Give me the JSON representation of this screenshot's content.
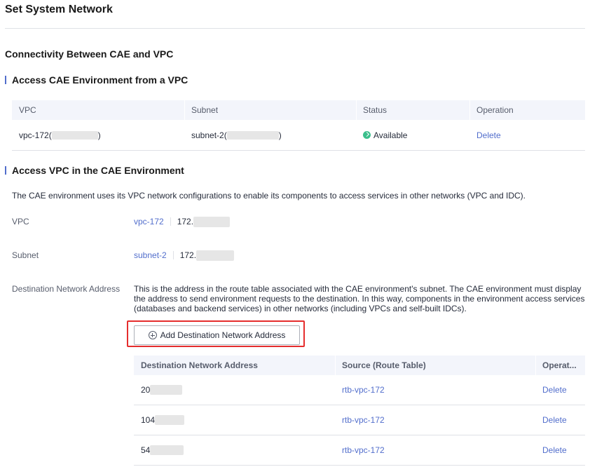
{
  "page_title": "Set System Network",
  "section_heading": "Connectivity Between CAE and VPC",
  "access_cae_from_vpc": {
    "heading": "Access CAE Environment from a VPC",
    "columns": [
      "VPC",
      "Subnet",
      "Status",
      "Operation"
    ],
    "rows": [
      {
        "vpc_prefix": "vpc-172(",
        "vpc_suffix": ")",
        "subnet_prefix": "subnet-2(",
        "subnet_suffix": ")",
        "status": "Available",
        "operation": "Delete"
      }
    ]
  },
  "access_vpc_in_cae": {
    "heading": "Access VPC in the CAE Environment",
    "description": "The CAE environment uses its VPC network configurations to enable its components to access services in other networks (VPC and IDC).",
    "vpc_label": "VPC",
    "vpc_link": "vpc-172",
    "vpc_cidr_prefix": "172.",
    "subnet_label": "Subnet",
    "subnet_link": "subnet-2",
    "subnet_cidr_prefix": "172.",
    "dest_label": "Destination Network Address",
    "dest_description": "This is the address in the route table associated with the CAE environment's subnet. The CAE environment must display the address to send environment requests to the destination. In this way, components in the environment access services (databases and backend services) in other networks (including VPCs and self-built IDCs).",
    "add_button_label": "Add Destination Network Address",
    "dest_columns": [
      "Destination Network Address",
      "Source (Route Table)",
      "Operat..."
    ],
    "dest_rows": [
      {
        "address_prefix": "20",
        "source": "rtb-vpc-172",
        "operation": "Delete"
      },
      {
        "address_prefix": "104",
        "source": "rtb-vpc-172",
        "operation": "Delete"
      },
      {
        "address_prefix": "54",
        "source": "rtb-vpc-172",
        "operation": "Delete"
      }
    ]
  },
  "colors": {
    "link": "#526ecc",
    "status_available": "#3bbf8c",
    "highlight": "#e52d2d",
    "table_header_bg": "#f3f5fb"
  }
}
